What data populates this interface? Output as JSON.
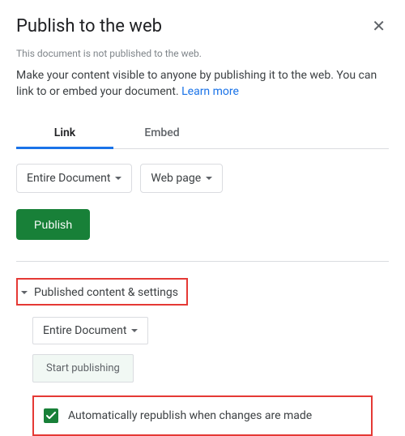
{
  "dialog": {
    "title": "Publish to the web",
    "subtitle": "This document is not published to the web.",
    "description_pre": "Make your content visible to anyone by publishing it to the web. You can link to or embed your document. ",
    "learn_more": "Learn more"
  },
  "tabs": {
    "link": "Link",
    "embed": "Embed"
  },
  "selects": {
    "scope": "Entire Document",
    "format": "Web page"
  },
  "buttons": {
    "publish": "Publish",
    "start_publishing": "Start publishing"
  },
  "sections": {
    "published_settings": "Published content & settings",
    "scope2": "Entire Document",
    "auto_republish": "Automatically republish when changes are made"
  }
}
